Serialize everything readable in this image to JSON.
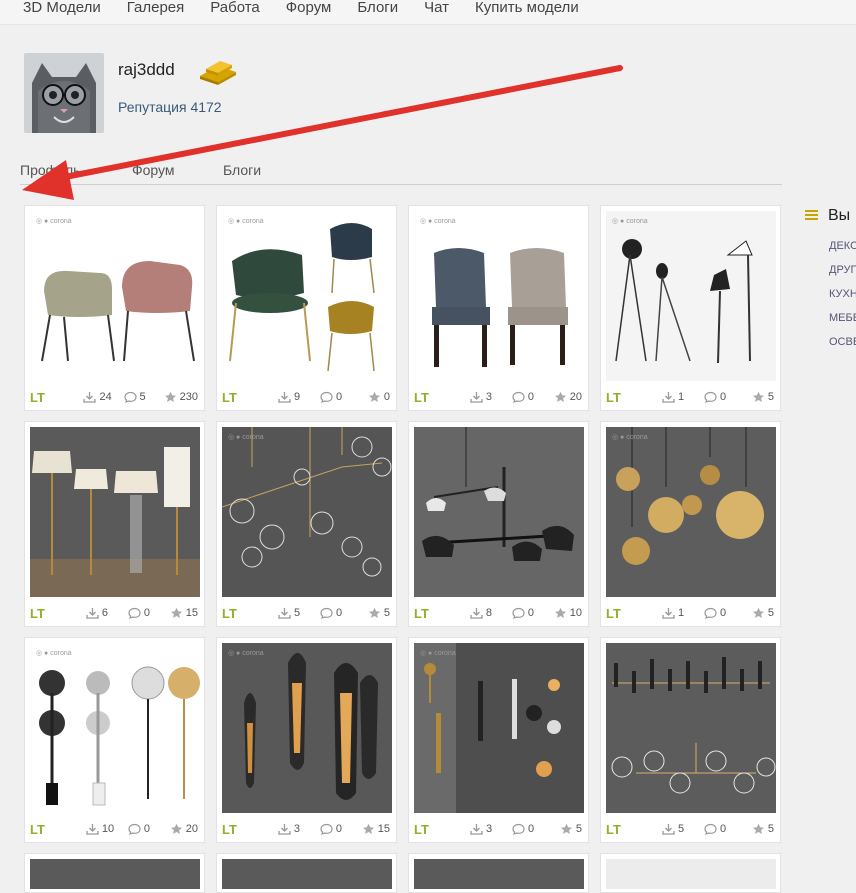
{
  "nav": [
    "3D Модели",
    "Галерея",
    "Работа",
    "Форум",
    "Блоги",
    "Чат",
    "Купить модели"
  ],
  "profile": {
    "username": "raj3ddd",
    "reputation": "Репутация 4172"
  },
  "tabs": [
    "Профиль",
    "Форум",
    "Блоги"
  ],
  "sidebar": {
    "title": "Вы",
    "items": [
      "ДЕКО",
      "ДРУГ",
      "КУХН",
      "МЕБЕ",
      "ОСВЕ"
    ]
  },
  "badge_colors": {
    "lt": "#8cb32a",
    "accent": "#c9a400",
    "arrow": "#e0312a"
  },
  "cards": [
    {
      "badge": "LT",
      "downloads": "24",
      "comments": "5",
      "favorites": "230",
      "watermark": "corona",
      "theme": "chairs-light"
    },
    {
      "badge": "LT",
      "downloads": "9",
      "comments": "0",
      "favorites": "0",
      "watermark": "corona",
      "theme": "chairs-green"
    },
    {
      "badge": "LT",
      "downloads": "3",
      "comments": "0",
      "favorites": "20",
      "watermark": "corona",
      "theme": "chairs-tufted"
    },
    {
      "badge": "LT",
      "downloads": "1",
      "comments": "0",
      "favorites": "5",
      "watermark": "corona",
      "theme": "floor-lamps"
    },
    {
      "badge": "LT",
      "downloads": "6",
      "comments": "0",
      "favorites": "15",
      "watermark": "",
      "theme": "lamps-shade"
    },
    {
      "badge": "LT",
      "downloads": "5",
      "comments": "0",
      "favorites": "5",
      "watermark": "corona",
      "theme": "bubble-chandelier"
    },
    {
      "badge": "LT",
      "downloads": "8",
      "comments": "0",
      "favorites": "10",
      "watermark": "",
      "theme": "black-pendant"
    },
    {
      "badge": "LT",
      "downloads": "1",
      "comments": "0",
      "favorites": "5",
      "watermark": "corona",
      "theme": "gold-pendants"
    },
    {
      "badge": "LT",
      "downloads": "10",
      "comments": "0",
      "favorites": "20",
      "watermark": "corona",
      "theme": "disc-floor-lamps"
    },
    {
      "badge": "LT",
      "downloads": "3",
      "comments": "0",
      "favorites": "15",
      "watermark": "corona",
      "theme": "wall-sconces"
    },
    {
      "badge": "LT",
      "downloads": "3",
      "comments": "0",
      "favorites": "5",
      "watermark": "corona",
      "theme": "wall-lights"
    },
    {
      "badge": "LT",
      "downloads": "5",
      "comments": "0",
      "favorites": "5",
      "watermark": "",
      "theme": "linear-chandelier"
    }
  ]
}
